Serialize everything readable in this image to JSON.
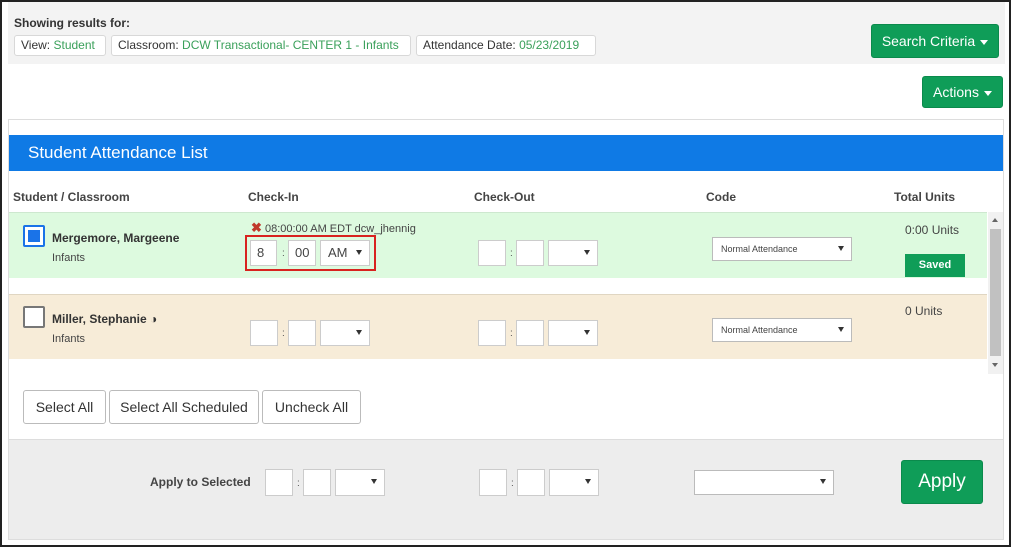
{
  "filters": {
    "showing_label": "Showing results for:",
    "view_label": "View:",
    "view_value": "Student",
    "classroom_label": "Classroom:",
    "classroom_value": "DCW Transactional- CENTER 1 - Infants",
    "date_label": "Attendance Date:",
    "date_value": "05/23/2019"
  },
  "buttons": {
    "search_criteria": "Search Criteria",
    "actions": "Actions",
    "select_all": "Select All",
    "select_all_scheduled": "Select All Scheduled",
    "uncheck_all": "Uncheck All",
    "apply": "Apply"
  },
  "panel": {
    "title": "Student Attendance List",
    "columns": [
      "Student / Classroom",
      "Check-In",
      "Check-Out",
      "Code",
      "Total Units"
    ]
  },
  "rows": [
    {
      "name": "Mergemore, Margeene",
      "classroom": "Infants",
      "checked": true,
      "checkin_log": "08:00:00 AM EDT dcw_jhennig",
      "checkin_hour": "8",
      "checkin_min": "00",
      "checkin_ampm": "AM",
      "code": "Normal Attendance",
      "units": "0:00 Units",
      "status": "Saved"
    },
    {
      "name": "Miller, Stephanie",
      "name_icon": "◑",
      "classroom": "Infants",
      "checked": false,
      "code": "Normal Attendance",
      "units": "0 Units"
    }
  ],
  "apply_bar": {
    "label": "Apply to Selected"
  },
  "glyphs": {
    "colon": ":",
    "xmark": "✖"
  },
  "colors": {
    "accent_blue": "#0f7ae5",
    "green": "#0f9d58",
    "row_checked_bg": "#ddfadf",
    "row_unchecked_bg": "#f7ecd8",
    "highlight_red": "#d8231f"
  }
}
